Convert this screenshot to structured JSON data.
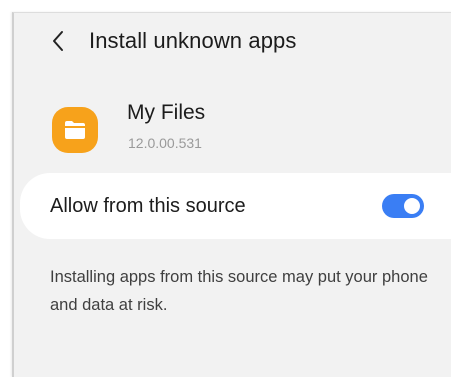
{
  "header": {
    "back_icon": "chevron-left-icon",
    "title": "Install unknown apps"
  },
  "app": {
    "icon": "folder-icon",
    "icon_color": "#f7a21b",
    "name": "My Files",
    "version": "12.0.00.531"
  },
  "setting": {
    "label": "Allow from this source",
    "enabled": true,
    "accent_color": "#3a7ef4"
  },
  "warning": {
    "text": "Installing apps from this source may put your phone and data at risk."
  }
}
